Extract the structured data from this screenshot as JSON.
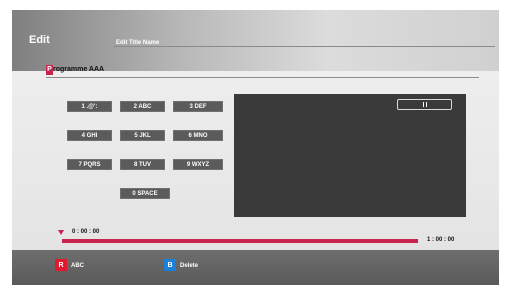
{
  "header": {
    "title": "Edit",
    "subtitle": "Edit Title Name"
  },
  "field": {
    "cursor_char": "P",
    "value": "rogramme AAA"
  },
  "keypad": {
    "k1": "1  .@':",
    "k2": "2  ABC",
    "k3": "3  DEF",
    "k4": "4  GHI",
    "k5": "5  JKL",
    "k6": "6  MNO",
    "k7": "7  PQRS",
    "k8": "8  TUV",
    "k9": "9  WXYZ",
    "k0": "0  SPACE"
  },
  "player": {
    "start_time": "0 : 00 : 00",
    "end_time": "1 : 00 : 00",
    "progress_fraction": 1.0
  },
  "footer": {
    "red_key": "R",
    "red_label": "ABC",
    "blue_key": "B",
    "blue_label": "Delete"
  },
  "colors": {
    "accent": "#c9234f",
    "red": "#e1192f",
    "blue": "#1e7fd6",
    "key_bg": "#5b5b5b"
  },
  "icons": {
    "pause": "pause-icon",
    "position_marker": "position-marker-icon"
  }
}
